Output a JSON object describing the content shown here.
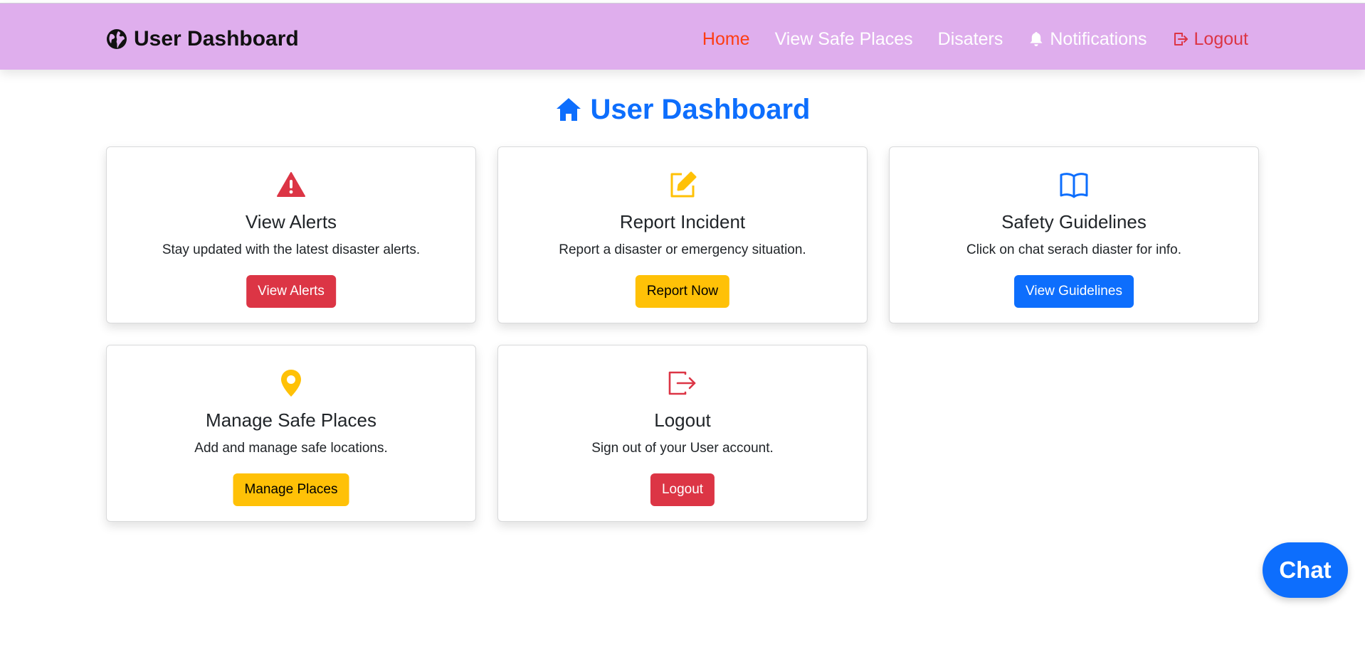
{
  "navbar": {
    "brand": "User Dashboard",
    "brand_icon": "globe-icon",
    "items": [
      {
        "label": "Home",
        "state": "active"
      },
      {
        "label": "View Safe Places"
      },
      {
        "label": "Disaters"
      },
      {
        "label": "Notifications",
        "icon": "bell-icon"
      },
      {
        "label": "Logout",
        "icon": "logout-icon"
      }
    ]
  },
  "page_title": {
    "text": "User Dashboard",
    "icon": "home-icon"
  },
  "cards": [
    {
      "icon": "warning-triangle-icon",
      "icon_color": "#dc3545",
      "title": "View Alerts",
      "description": "Stay updated with the latest disaster alerts.",
      "button": "View Alerts",
      "button_color": "#dc3545"
    },
    {
      "icon": "edit-icon",
      "icon_color": "#ffc107",
      "title": "Report Incident",
      "description": "Report a disaster or emergency situation.",
      "button": "Report Now",
      "button_color": "#ffc107"
    },
    {
      "icon": "book-icon",
      "icon_color": "#0d6efd",
      "title": "Safety Guidelines",
      "description": "Click on chat serach diaster for info.",
      "button": "View Guidelines",
      "button_color": "#0d6efd"
    },
    {
      "icon": "location-pin-icon",
      "icon_color": "#ffc107",
      "title": "Manage Safe Places",
      "description": "Add and manage safe locations.",
      "button": "Manage Places",
      "button_color": "#ffc107"
    },
    {
      "icon": "logout-icon",
      "icon_color": "#dc3545",
      "title": "Logout",
      "description": "Sign out of your User account.",
      "button": "Logout",
      "button_color": "#dc3545"
    }
  ],
  "chat": {
    "label": "Chat"
  },
  "colors": {
    "navbar_bg": "#dfaeed",
    "primary": "#0d6efd",
    "danger": "#dc3545",
    "warning": "#ffc107",
    "active_nav": "#fd3d14"
  }
}
